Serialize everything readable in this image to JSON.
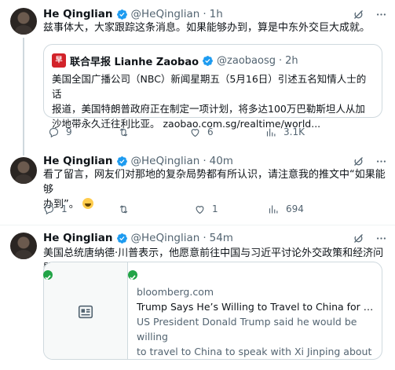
{
  "colors": {
    "accent": "#1d9bf0",
    "text": "#0f1419",
    "muted": "#536471",
    "border": "#cfd9de",
    "badge_green": "#22a447",
    "logo_red": "#d2232a"
  },
  "tweets": [
    {
      "name": "He Qinglian",
      "handle": "@HeQinglian",
      "time": "1h",
      "text": "兹事体大，大家跟踪这条消息。如果能够办到，算是中东外交巨大成就。",
      "quote": {
        "logo_text": "早",
        "name": "联合早报 Lianhe Zaobao",
        "handle": "@zaobaosg",
        "time": "2h",
        "lines": [
          "美国全国广播公司（NBC）新闻星期五（5月16日）引述五名知情人士的话",
          "报道，美国特朗普政府正在制定一项计划，将多达100万巴勒斯坦人从加",
          "沙地带永久迁往利比亚。 zaobao.com.sg/realtime/world..."
        ]
      },
      "replies": "9",
      "retweets": "",
      "likes": "6",
      "views": "3.1K"
    },
    {
      "name": "He Qinglian",
      "handle": "@HeQinglian",
      "time": "40m",
      "lines": [
        "看了留言，网友们对那地的复杂局势都有所认识，请注意我的推文中“如果能够",
        "办到”。"
      ],
      "replies": "1",
      "retweets": "",
      "likes": "1",
      "views": "694"
    },
    {
      "name": "He Qinglian",
      "handle": "@HeQinglian",
      "time": "54m",
      "text": "美国总统唐纳德·川普表示，他愿意前往中国与习近平讨论外交政策和经济问题",
      "card": {
        "domain": "bloomberg.com",
        "title": "Trump Says He’s Willing to Travel to China for Xi M...",
        "desc_lines": [
          "US President Donald Trump said he would be willing",
          "to travel to China to speak with Xi Jinping about ..."
        ]
      }
    }
  ],
  "icons": [
    "verified-badge-icon",
    "grok-icon",
    "more-icon",
    "reply-icon",
    "retweet-icon",
    "like-icon",
    "views-icon",
    "article-icon",
    "check-icon"
  ]
}
